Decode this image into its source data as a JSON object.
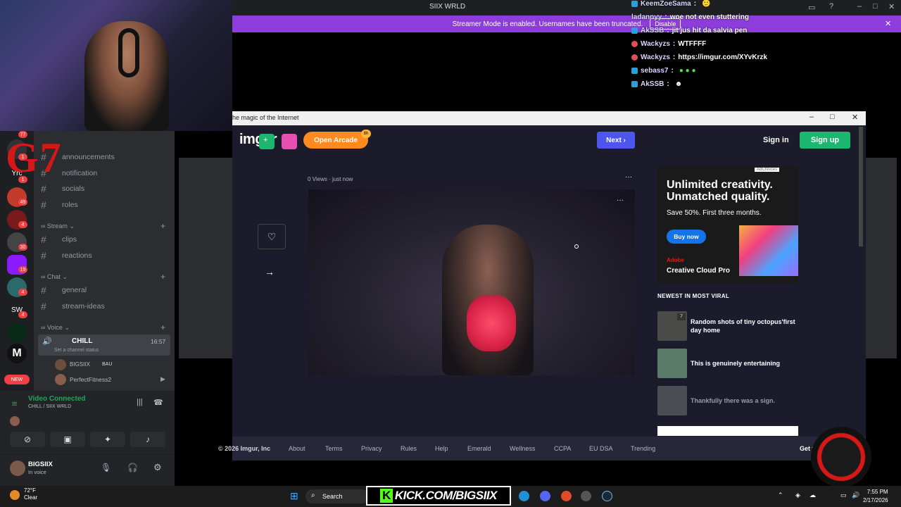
{
  "window": {
    "title": "SIIX WRLD"
  },
  "streamer_mode": {
    "text": "Streamer Mode is enabled. Usernames have been truncated.",
    "button": "Disable"
  },
  "chat": [
    {
      "name": "KeemZoeSama",
      "text": ""
    },
    {
      "name": "ladannyy",
      "text": "woe not even stuttering"
    },
    {
      "name": "AkSSB",
      "text": "jit jus hit da salvia pen"
    },
    {
      "name": "Wackyzs",
      "text": "WTFFFF"
    },
    {
      "name": "Wackyzs",
      "text": "https://imgur.com/XYvKrzk"
    },
    {
      "name": "sebass7",
      "text": ""
    },
    {
      "name": "AkSSB",
      "text": ""
    }
  ],
  "overlay": {
    "g7": "G7"
  },
  "guilds": {
    "badges": [
      "77",
      "1",
      "1",
      "49",
      "4",
      "30",
      "19",
      "4",
      "4"
    ],
    "labels": [
      "Yrc",
      "SW",
      "M"
    ],
    "new_label": "NEW"
  },
  "channels": {
    "top": [
      "announcements",
      "notification",
      "socials",
      "roles"
    ],
    "stream_category": "Stream",
    "stream": [
      "clips",
      "reactions"
    ],
    "chat_category": "Chat",
    "chat": [
      "general",
      "stream-ideas"
    ],
    "voice_category": "Voice",
    "voice_channel": "CHILL",
    "voice_timer": "16:57",
    "voice_status": "Set a channel status",
    "members": [
      {
        "name": "BIGSIIX",
        "tag": "BAU"
      },
      {
        "name": "PerfectFitness2",
        "tag": ""
      }
    ]
  },
  "voice_panel": {
    "status": "Video Connected",
    "location": "CHILL / SIIX WRLD"
  },
  "user_panel": {
    "name": "BIGSIIX",
    "status": "In voice"
  },
  "browser": {
    "tab_title": "he magic of the Internet",
    "nav": {
      "logo": "imgur",
      "arcade": "Open Arcade",
      "arcade_badge": "8h",
      "next": "Next",
      "signin": "Sign in",
      "signup": "Sign up"
    },
    "post": {
      "meta": "0 Views · just now"
    },
    "ad": {
      "headline": "Unlimited creativity. Unmatched quality.",
      "sub": "Save 50%. First three months.",
      "cta": "Buy now",
      "brand_small": "Adobe",
      "brand": "Creative Cloud Pro",
      "adchoices": "AdChoices"
    },
    "viral_heading": "NEWEST IN MOST VIRAL",
    "viral": [
      {
        "title": "Random shots of tiny octopus'first day home",
        "badge": "7"
      },
      {
        "title": "This is genuinely entertaining",
        "badge": ""
      },
      {
        "title": "Thankfully there was a sign.",
        "badge": ""
      }
    ],
    "footer": [
      "© 2026 Imgur, Inc",
      "About",
      "Terms",
      "Privacy",
      "Rules",
      "Help",
      "Emerald",
      "Wellness",
      "CCPA",
      "EU DSA",
      "Trending"
    ],
    "footer_cta": "Get the"
  },
  "taskbar": {
    "weather_temp": "72°F",
    "weather_desc": "Clear",
    "search": "Search",
    "kick": "KICK.COM/BIGSIIX",
    "time": "7:55 PM",
    "date": "2/17/2026"
  },
  "colors": {
    "accent_purple": "#8c3ddb",
    "imgur_next": "#4c55ec",
    "imgur_signup": "#1bb76e",
    "arcade": "#ff8a1f",
    "kick_green": "#53fc18"
  }
}
